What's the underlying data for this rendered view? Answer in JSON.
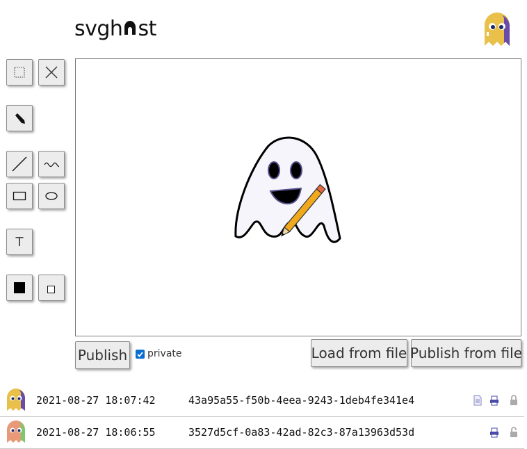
{
  "app": {
    "logo_text": "svgh",
    "logo_text_end": "st",
    "avatar_icon": "ghost-avatar-icon"
  },
  "toolbar": {
    "tools": [
      {
        "name": "select-tool",
        "icon": "dotted-rect-icon"
      },
      {
        "name": "delete-tool",
        "icon": "close-icon"
      },
      {
        "name": "pen-tool",
        "icon": "pen-icon"
      },
      {
        "name": "line-tool",
        "icon": "line-icon"
      },
      {
        "name": "freehand-tool",
        "icon": "wave-icon"
      },
      {
        "name": "rect-tool",
        "icon": "rect-icon"
      },
      {
        "name": "ellipse-tool",
        "icon": "ellipse-icon"
      },
      {
        "name": "text-tool",
        "icon": "text-icon",
        "label": "T"
      },
      {
        "name": "fill-black-tool",
        "icon": "filled-square-icon"
      },
      {
        "name": "fill-white-tool",
        "icon": "hollow-square-icon"
      }
    ]
  },
  "canvas": {
    "content_icon": "ghost-with-pencil-icon"
  },
  "actions": {
    "publish_label": "Publish",
    "private_label": "private",
    "private_checked": true,
    "load_label": "Load from file",
    "publish_file_label": "Publish from file"
  },
  "colors": {
    "accent": "#0a6ed1",
    "button_bg": "#ececec",
    "ghost_yellow": "#e8c04a",
    "ghost_purple": "#6a4ba8"
  },
  "history": [
    {
      "timestamp": "2021-08-27 18:07:42",
      "id": "43a95a55-f50b-4eea-9243-1deb4fe341e4",
      "icons": [
        "document-icon",
        "print-icon",
        "lock-icon"
      ]
    },
    {
      "timestamp": "2021-08-27 18:06:55",
      "id": "3527d5cf-0a83-42ad-82c3-87a13963d53d",
      "icons": [
        "print-icon",
        "unlock-icon"
      ]
    }
  ]
}
